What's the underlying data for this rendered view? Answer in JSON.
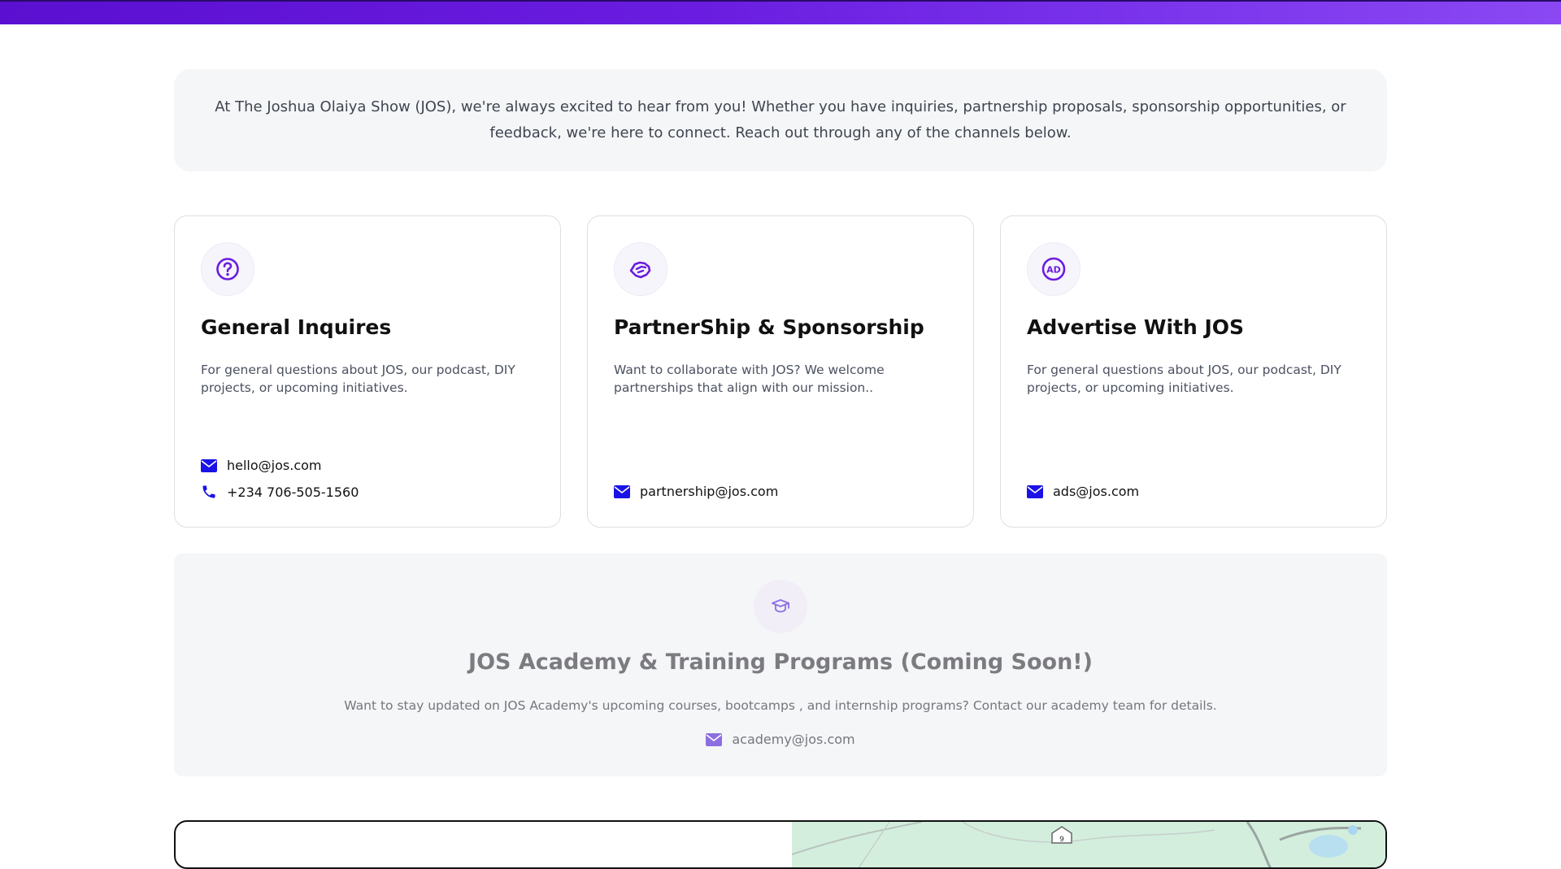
{
  "intro": {
    "text": "At The Joshua Olaiya Show (JOS), we're always excited to hear from you! Whether you have inquiries, partnership proposals, sponsorship opportunities, or feedback, we're here to connect. Reach out through any of the channels below."
  },
  "cards": [
    {
      "icon": "question-circle-icon",
      "title": "General Inquires",
      "description": "For general questions about JOS, our podcast, DIY projects, or upcoming initiatives.",
      "email": "hello@jos.com",
      "phone": "+234 706-505-1560"
    },
    {
      "icon": "handshake-icon",
      "title": "PartnerShip & Sponsorship",
      "description": "Want to collaborate with JOS? We welcome partnerships that align with our mission..",
      "email": "partnership@jos.com"
    },
    {
      "icon": "ad-icon",
      "title": "Advertise With JOS",
      "description": "For general questions about JOS, our podcast, DIY projects, or upcoming initiatives.",
      "email": "ads@jos.com"
    }
  ],
  "academy": {
    "icon": "graduation-cap-icon",
    "title": "JOS Academy & Training Programs (Coming Soon!)",
    "description": "Want to stay updated on JOS Academy's upcoming courses, bootcamps , and internship programs? Contact our academy team for details.",
    "email": "academy@jos.com"
  },
  "colors": {
    "accent": "#6a1de0",
    "icon_blue": "#1a12e6",
    "muted_purple": "#8b6fe0"
  }
}
